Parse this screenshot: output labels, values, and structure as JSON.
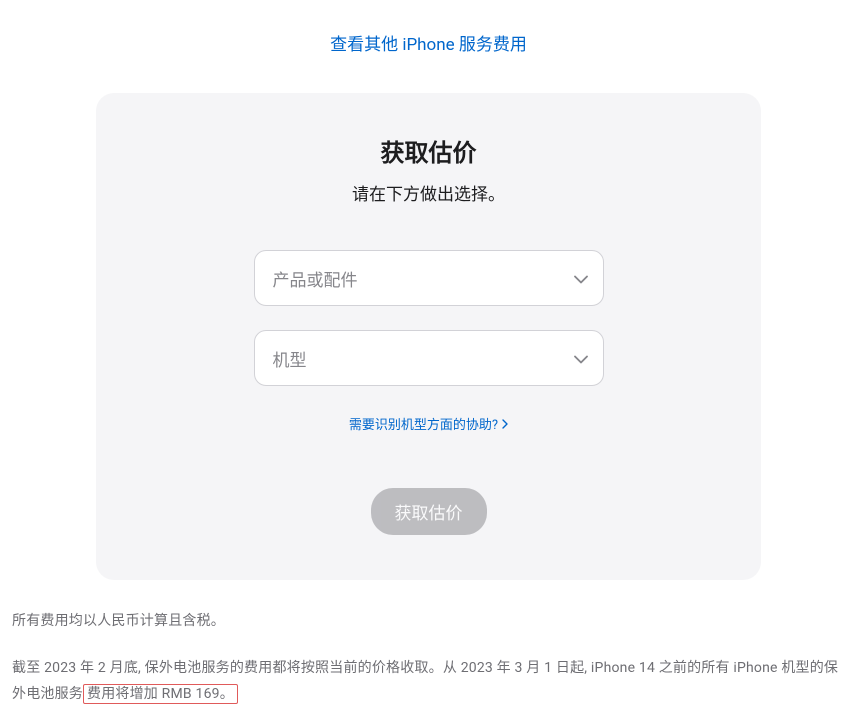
{
  "topLink": "查看其他 iPhone 服务费用",
  "card": {
    "title": "获取估价",
    "subtitle": "请在下方做出选择。",
    "select1Placeholder": "产品或配件",
    "select2Placeholder": "机型",
    "helpText": "需要识别机型方面的协助?",
    "submitLabel": "获取估价"
  },
  "note1": "所有费用均以人民币计算且含税。",
  "note2Prefix": "截至 2023 年 2 月底, 保外电池服务的费用都将按照当前的价格收取。从 2023 年 3 月 1 日起, iPhone 14 之前的所有 iPhone 机型的保外电池服务",
  "note2Highlight": "费用将增加 RMB 169。"
}
